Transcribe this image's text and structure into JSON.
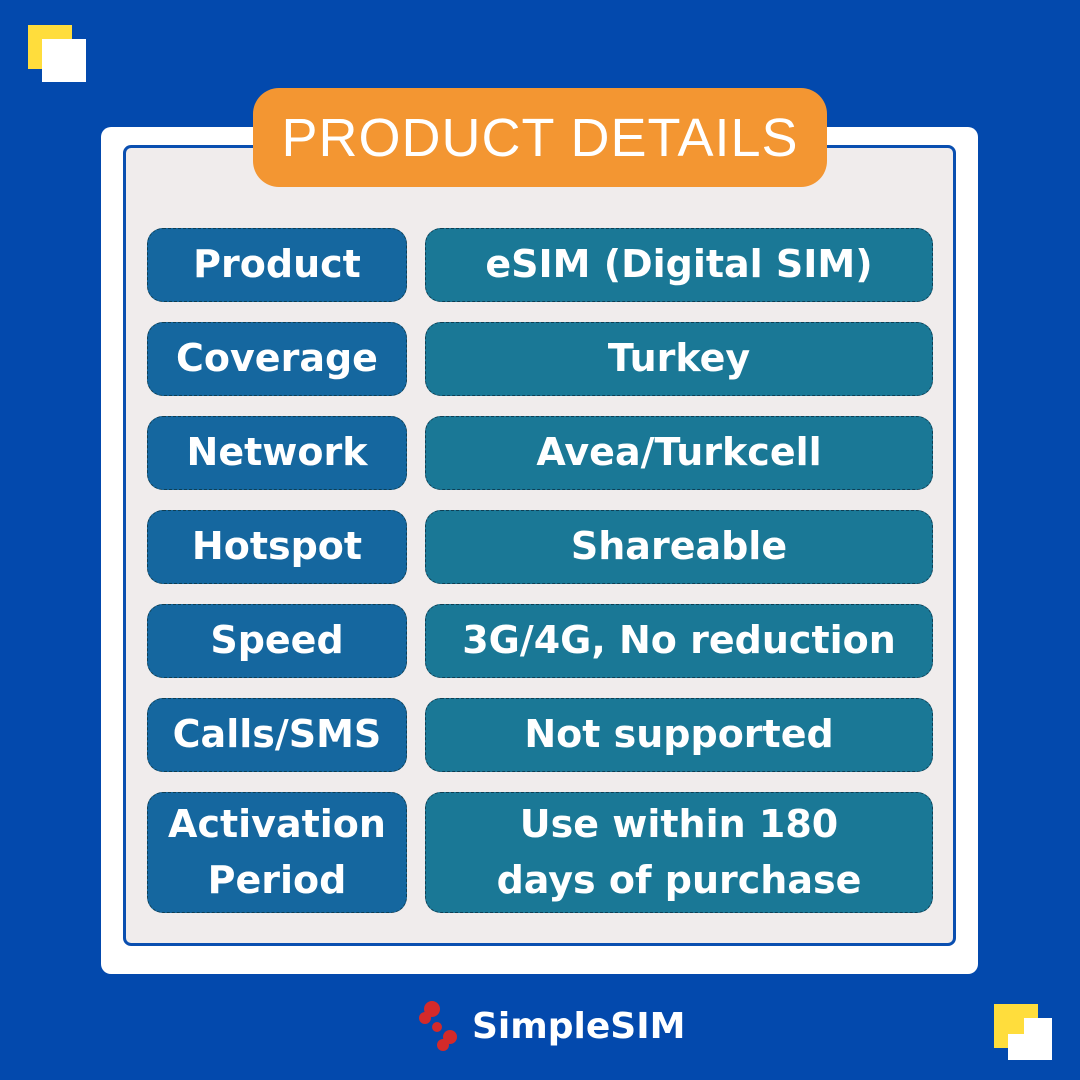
{
  "title": "PRODUCT DETAILS",
  "rows": [
    {
      "label": "Product",
      "value": "eSIM (Digital SIM)"
    },
    {
      "label": "Coverage",
      "value": "Turkey"
    },
    {
      "label": "Network",
      "value": "Avea/Turkcell"
    },
    {
      "label": "Hotspot",
      "value": "Shareable"
    },
    {
      "label": "Speed",
      "value": "3G/4G, No reduction"
    },
    {
      "label": "Calls/SMS",
      "value": "Not supported"
    },
    {
      "label": "Activation Period",
      "value": "Use within 180 days of purchase"
    }
  ],
  "brand": {
    "name": "SimpleSIM"
  },
  "colors": {
    "background": "#0349ad",
    "title": "#f39632",
    "label": "#15679f",
    "value": "#1a7896",
    "accent": "#ffdd3c"
  }
}
